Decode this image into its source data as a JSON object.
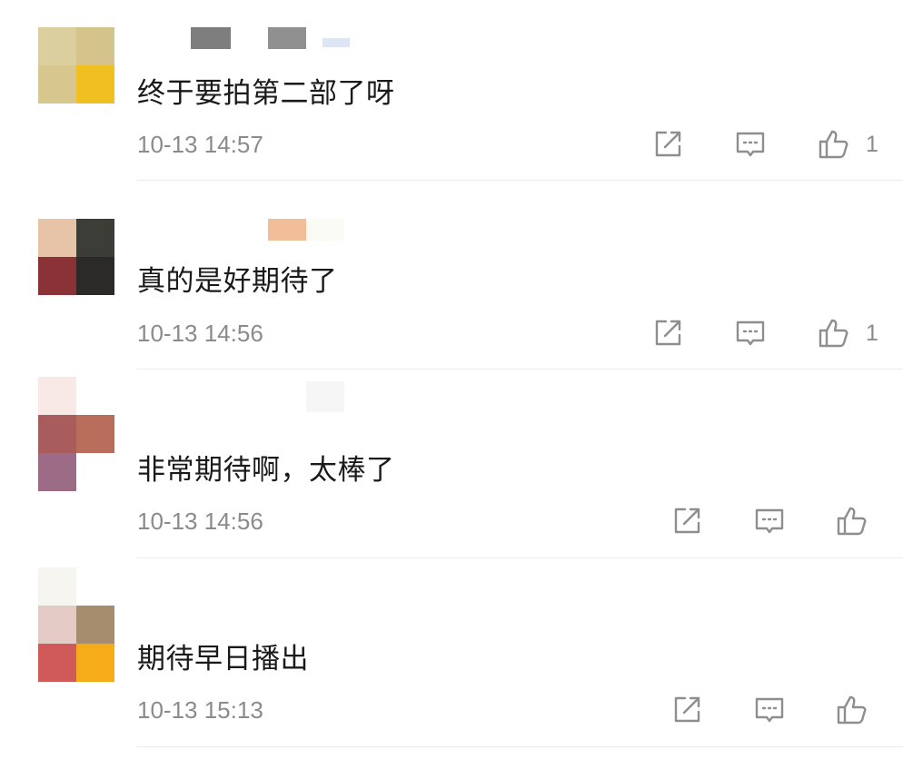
{
  "comments": [
    {
      "text": "终于要拍第二部了呀",
      "time": "10-13 14:57",
      "likes": "1",
      "avatar": [
        "#dccf9f",
        "#d4c48c",
        "#d7c68e",
        "#f0c020"
      ],
      "name_blocks": [
        "#7e7e7e",
        "#909090"
      ]
    },
    {
      "text": "真的是好期待了",
      "time": "10-13 14:56",
      "likes": "1",
      "avatar": [
        "#e7c4a7",
        "#3d3d38",
        "#8a3235",
        "#2b2a28"
      ],
      "name_blocks": [
        "#f2be97",
        "#fbfbf5"
      ]
    },
    {
      "text": "非常期待啊，太棒了",
      "time": "10-13 14:56",
      "likes": "",
      "avatar": [
        "#f8e8e6",
        "#ffffff",
        "#a85d5c",
        "#b96e5c",
        "#9c6b86",
        "#ffffff"
      ],
      "name_blocks": [
        "#f9f9f9",
        "#f3f3f3"
      ]
    },
    {
      "text": "期待早日播出",
      "time": "10-13 15:13",
      "likes": "",
      "avatar": [
        "#f7f5ef",
        "#ffffff",
        "#e5cbc5",
        "#a58d6d",
        "#d05959",
        "#f6ac18"
      ],
      "name_blocks": [
        "#ffffff",
        "#ffffff"
      ]
    }
  ],
  "icons": {
    "share": "share-icon",
    "reply": "comment-icon",
    "like": "thumbs-up-icon"
  }
}
